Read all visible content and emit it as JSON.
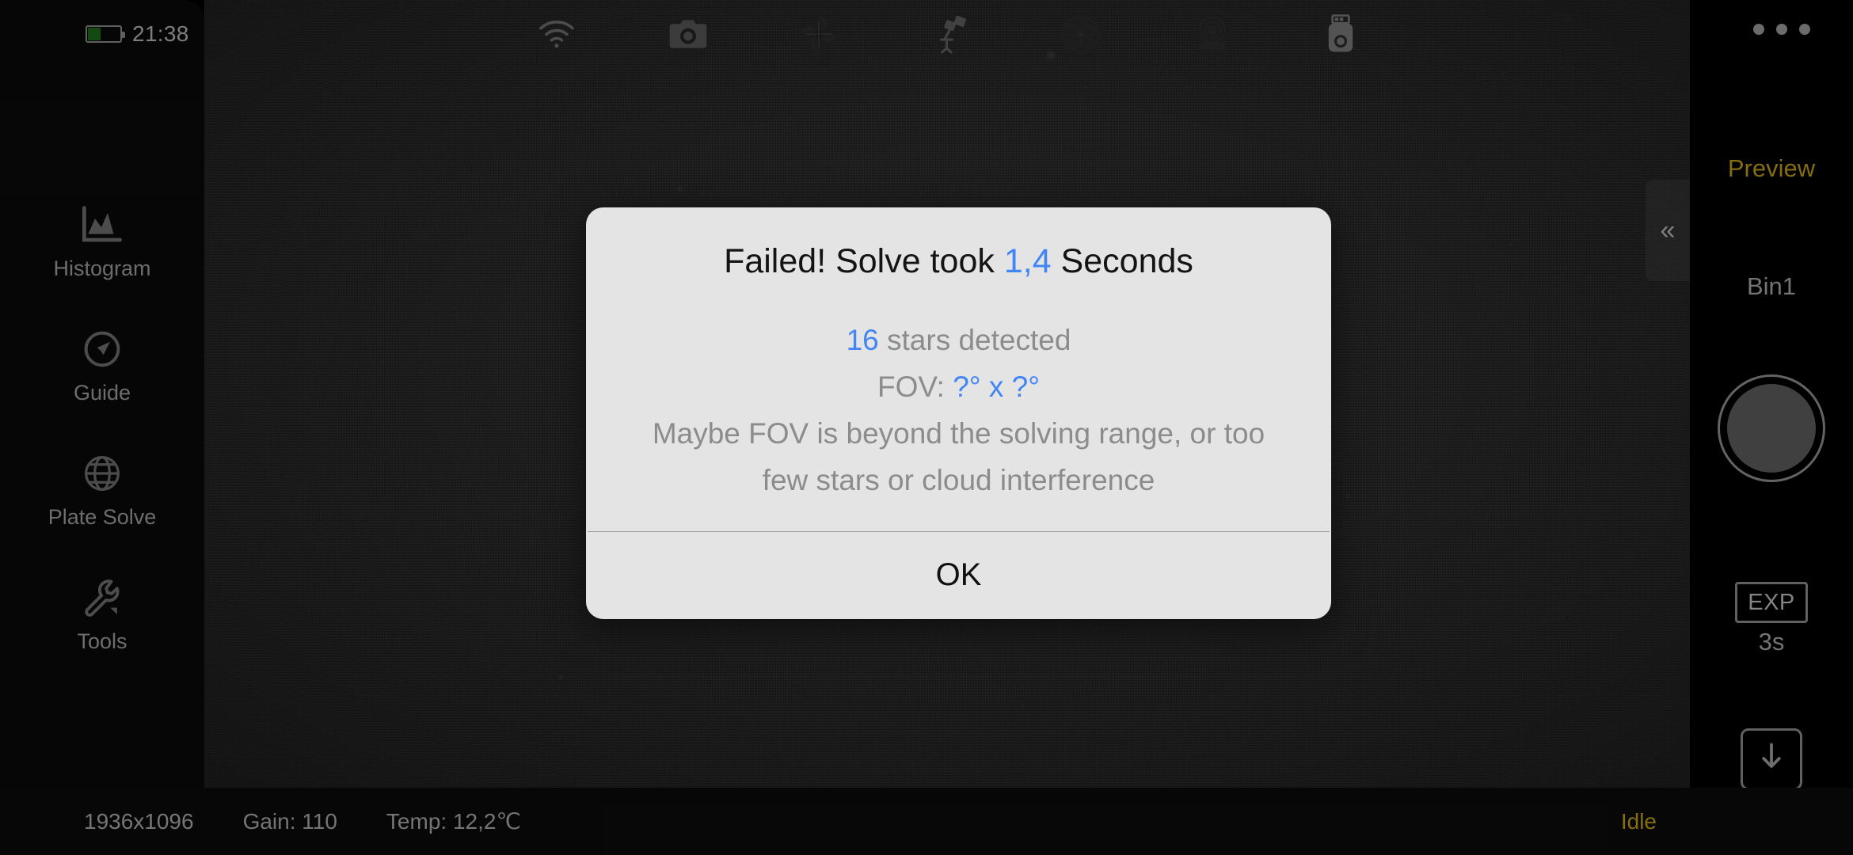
{
  "status_bar": {
    "clock": "21:38",
    "battery_level_pct": 38,
    "overflow_menu_label": "•••"
  },
  "top_toolbar": {
    "icons": [
      {
        "name": "wifi-icon",
        "label": "Wi-Fi"
      },
      {
        "name": "camera-icon",
        "label": "Main Camera"
      },
      {
        "name": "focuser-icon",
        "label": "Focuser"
      },
      {
        "name": "telescope-icon",
        "label": "Telescope Mount"
      },
      {
        "name": "filter-wheel-icon",
        "label": "Filter Wheel"
      },
      {
        "name": "guide-camera-icon",
        "label": "Guide Camera"
      },
      {
        "name": "usb-drive-icon",
        "label": "USB Storage"
      }
    ]
  },
  "left_sidebar": {
    "items": [
      {
        "label": "Histogram",
        "icon": "histogram-icon"
      },
      {
        "label": "Guide",
        "icon": "compass-icon"
      },
      {
        "label": "Plate Solve",
        "icon": "globe-icon"
      },
      {
        "label": "Tools",
        "icon": "wrench-icon"
      }
    ]
  },
  "right_sidebar": {
    "preview_label": "Preview",
    "bin_label": "Bin1",
    "shutter_label": "Capture",
    "exp_label": "EXP",
    "exp_value": "3s",
    "download_icon": "download-icon",
    "collapse_label": "«"
  },
  "bottom_bar": {
    "resolution": "1936x1096",
    "gain": "Gain: 110",
    "temperature": "Temp: 12,2℃",
    "status": "Idle"
  },
  "dialog": {
    "title_prefix": "Failed! Solve took ",
    "title_value": "1,4",
    "title_suffix": " Seconds",
    "stars_count": "16",
    "stars_label": " stars detected",
    "fov_label": "FOV: ",
    "fov_value": "?° x ?°",
    "hint_line1": "Maybe FOV is beyond the solving range, or too",
    "hint_line2": "few stars or cloud interference",
    "ok_label": "OK"
  },
  "colors": {
    "accent_blue": "#4285f4",
    "accent_gold": "#bf9c18",
    "dialog_bg": "#e4e4e4",
    "muted_text": "#8c8c8c"
  }
}
